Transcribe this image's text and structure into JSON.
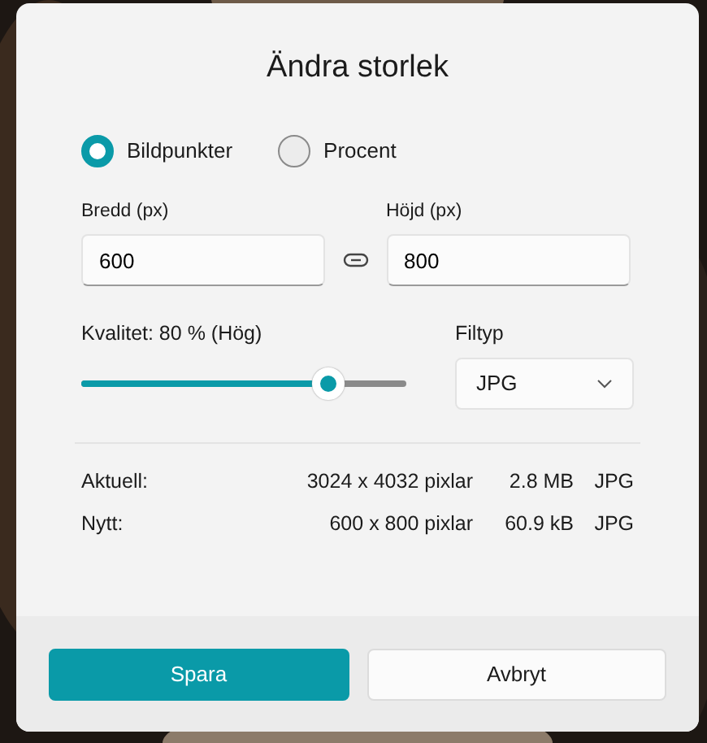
{
  "dialog": {
    "title": "Ändra storlek"
  },
  "units": [
    {
      "label": "Bildpunkter",
      "selected": true
    },
    {
      "label": "Procent",
      "selected": false
    }
  ],
  "width": {
    "label": "Bredd  (px)",
    "value": "600"
  },
  "height": {
    "label": "Höjd  (px)",
    "value": "800"
  },
  "quality": {
    "label": "Kvalitet: 80 % (Hög)",
    "level": 0.76
  },
  "file_type": {
    "label": "Filtyp",
    "value": "JPG"
  },
  "info_rows": [
    {
      "label": "Aktuell:",
      "dimensions": "3024 x 4032 pixlar",
      "size": "2.8 MB",
      "format": "JPG"
    },
    {
      "label": "Nytt:",
      "dimensions": "600 x 800 pixlar",
      "size": "60.9 kB",
      "format": "JPG"
    }
  ],
  "buttons": [
    {
      "label": "Spara",
      "kind": "primary"
    },
    {
      "label": "Avbryt",
      "kind": "secondary"
    }
  ]
}
